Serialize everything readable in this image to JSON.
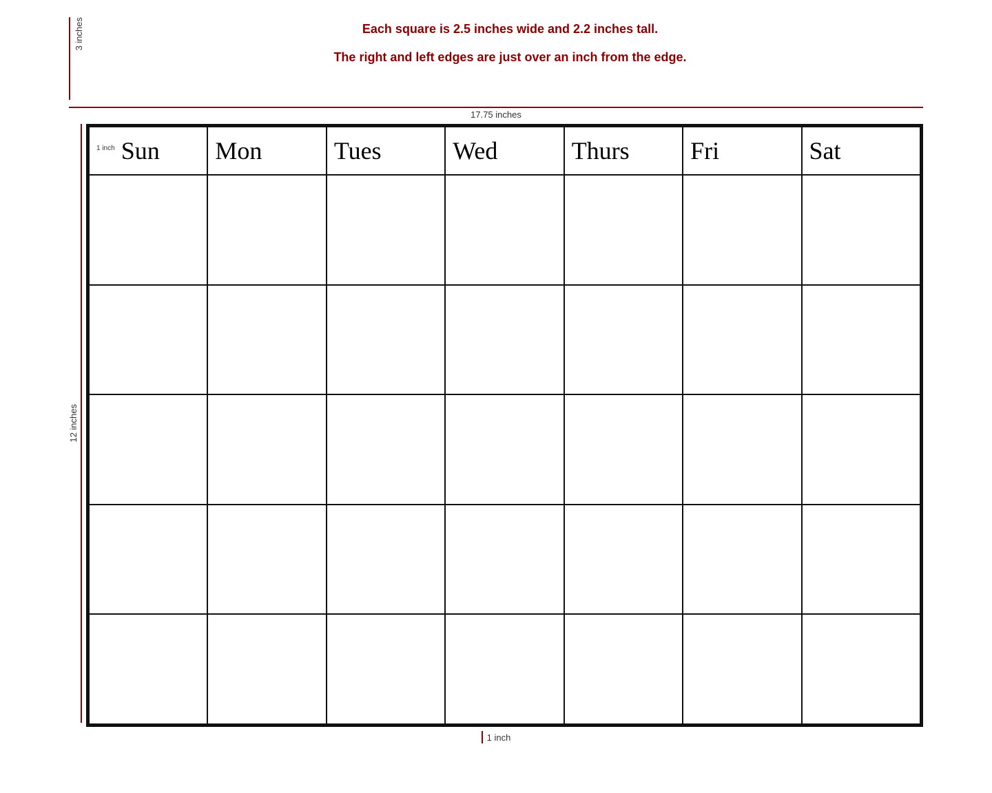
{
  "info": {
    "line1": "Each square is 2.5 inches wide and 2.2 inches tall.",
    "line2": "The right and left edges are just over an inch from the edge.",
    "width_label": "17.75 inches",
    "height_label": "12 inches",
    "top_height_label": "3 inches",
    "bottom_label": "1 inch"
  },
  "calendar": {
    "headers": [
      "Sun",
      "Mon",
      "Tues",
      "Wed",
      "Thurs",
      "Fri",
      "Sat"
    ],
    "rows": 5,
    "inch_annotation": "1 inch"
  }
}
